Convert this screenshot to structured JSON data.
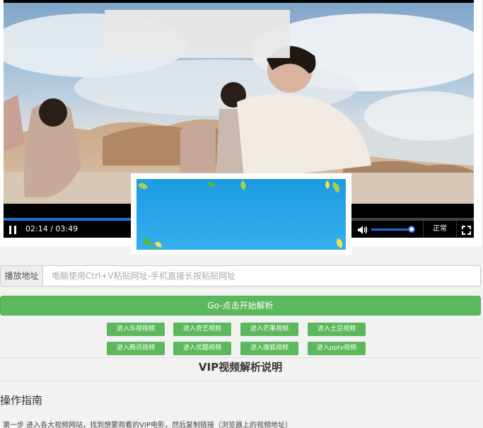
{
  "player": {
    "current_time": "02:14",
    "separator": " / ",
    "duration": "03:49",
    "progress": 0.585,
    "volume": 0.95,
    "speed_label": "正常"
  },
  "search": {
    "label": "播放地址",
    "placeholder": "电脑使用Ctrl+V粘贴网址-手机直接长按粘贴网址"
  },
  "go_button": "Go-点击开始解析",
  "site_buttons": [
    "进入乐视视频",
    "进入奇艺视频",
    "进入芒果视频",
    "进入土豆视频",
    "进入腾讯视频",
    "进入优酷视频",
    "进入搜狐视频",
    "进入pptv视频"
  ],
  "guide": {
    "title": "VIP视频解析说明",
    "heading": "操作指南",
    "step1": "第一步 进入各大视频网站，找到想要观看的VIP电影，然后复制链接（浏览器上的视频地址）"
  },
  "colors": {
    "accent_green": "#5cb85c",
    "progress_blue": "#1e6fd6",
    "ad_blue": "#2aa3e8"
  }
}
